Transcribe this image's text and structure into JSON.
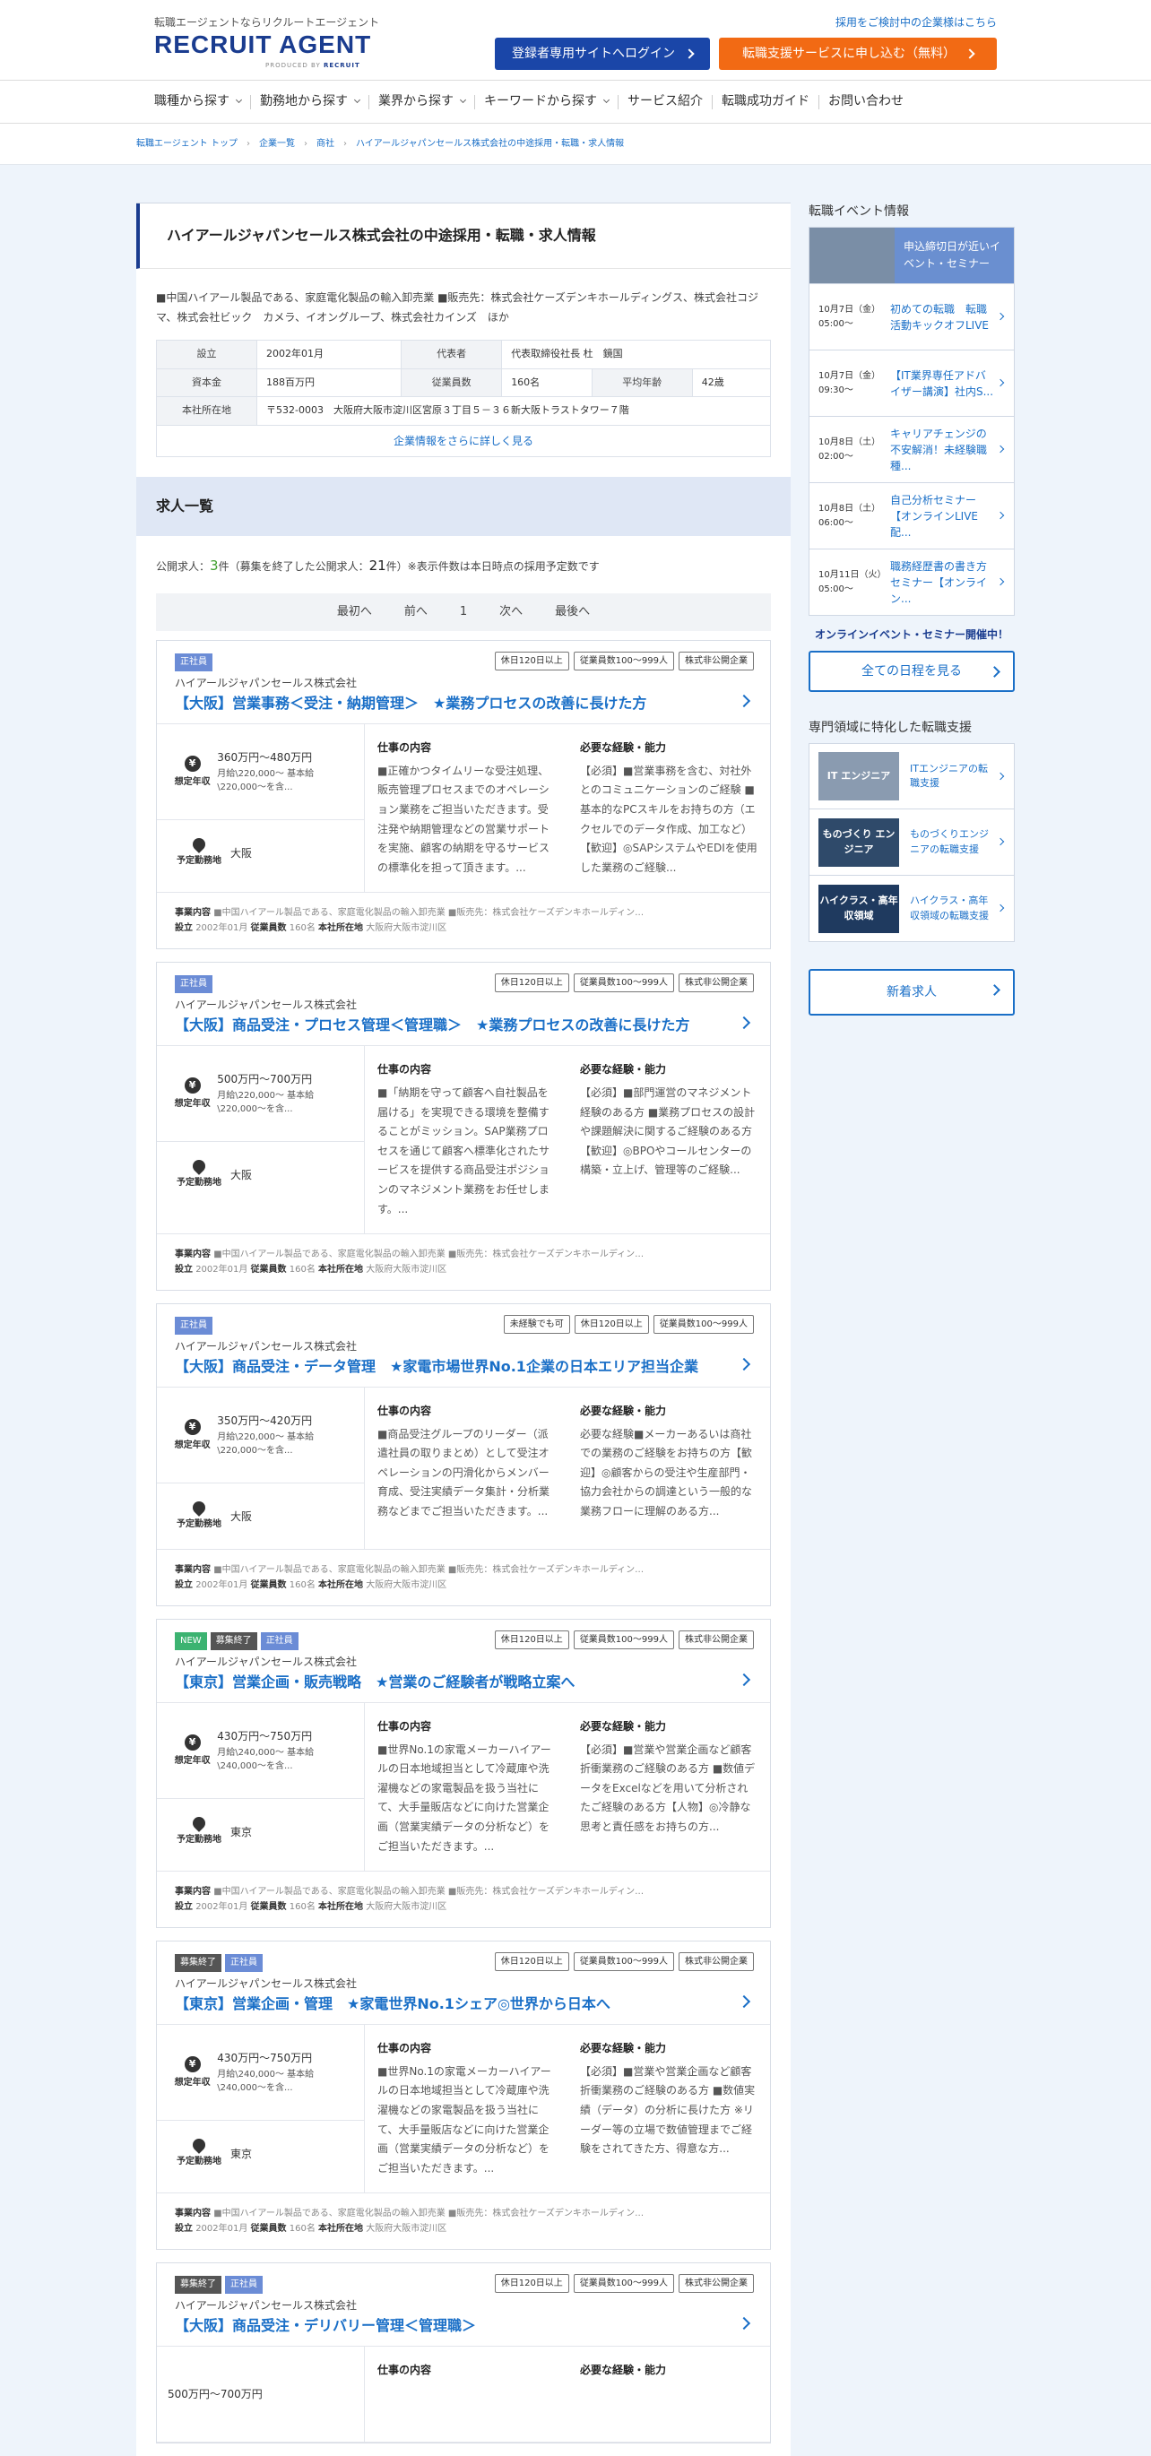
{
  "header": {
    "tagline": "転職エージェントならリクルートエージェント",
    "logo": "RECRUIT AGENT",
    "logo_sub": "PRODUCED BY",
    "logo_brand": "RECRUIT",
    "corp_link": "採用をご検討中の企業様はこちら",
    "login_btn": "登録者専用サイトへログイン",
    "apply_btn": "転職支援サービスに申し込む（無料）"
  },
  "nav": [
    "職種から探す",
    "勤務地から探す",
    "業界から探す",
    "キーワードから探す",
    "サービス紹介",
    "転職成功ガイド",
    "お問い合わせ"
  ],
  "breadcrumb": [
    "転職エージェント トップ",
    "企業一覧",
    "商社",
    "ハイアールジャパンセールス株式会社の中途採用・転職・求人情報"
  ],
  "company": {
    "title": "ハイアールジャパンセールス株式会社の中途採用・転職・求人情報",
    "summary": "■中国ハイアール製品である、家庭電化製品の輸入卸売業 ■販売先：株式会社ケーズデンキホールディングス、株式会社コジマ、株式会社ビック　カメラ、イオングループ、株式会社カインズ　ほか",
    "info": {
      "founded_label": "設立",
      "founded": "2002年01月",
      "rep_label": "代表者",
      "rep": "代表取締役社長 杜　鏡国",
      "capital_label": "資本金",
      "capital": "188百万円",
      "employees_label": "従業員数",
      "employees": "160名",
      "age_label": "平均年齢",
      "age": "42歳",
      "hq_label": "本社所在地",
      "hq": "〒532-0003　大阪府大阪市淀川区宮原３丁目５－３６新大阪トラストタワー７階"
    },
    "more": "企業情報をさらに詳しく見る"
  },
  "jobs_header": "求人一覧",
  "counts": {
    "pre": "公開求人：",
    "open": "3",
    "mid": "件（募集を終了した公開求人：",
    "closed": "21",
    "post": "件）※表示件数は本日時点の採用予定数です"
  },
  "pager": {
    "first": "最初へ",
    "prev": "前へ",
    "page": "1",
    "next": "次へ",
    "last": "最後へ"
  },
  "labels": {
    "salary": "想定年収",
    "location": "予定勤務地",
    "work": "仕事の内容",
    "req": "必要な経験・能力",
    "biz": "事業内容",
    "biz_text": "■中国ハイアール製品である、家庭電化製品の輸入卸売業 ■販売先：株式会社ケーズデンキホールディン…",
    "f_label": "設立",
    "f_val": "2002年01月",
    "e_label": "従業員数",
    "e_val": "160名",
    "h_label": "本社所在地",
    "h_val": "大阪府大阪市淀川区"
  },
  "jobs": [
    {
      "tags": [
        "正社員"
      ],
      "features": [
        "休日120日以上",
        "従業員数100～999人",
        "株式非公開企業"
      ],
      "company": "ハイアールジャパンセールス株式会社",
      "title": "【大阪】営業事務＜受注・納期管理＞　★業務プロセスの改善に長けた方",
      "salary": "360万円～480万円",
      "salary_sub": "月給\\220,000～ 基本給\\220,000～を含...",
      "location": "大阪",
      "work": "■正確かつタイムリーな受注処理、販売管理プロセスまでのオペレーション業務をご担当いただきます。受注発や納期管理などの営業サポートを実施、顧客の納期を守るサービスの標準化を担って頂きます。...",
      "req": "【必須】■営業事務を含む、対社外とのコミュニケーションのご経験 ■基本的なPCスキルをお持ちの方（エクセルでのデータ作成、加工など）【歓迎】◎SAPシステムやEDIを使用した業務のご経験..."
    },
    {
      "tags": [
        "正社員"
      ],
      "features": [
        "休日120日以上",
        "従業員数100～999人",
        "株式非公開企業"
      ],
      "company": "ハイアールジャパンセールス株式会社",
      "title": "【大阪】商品受注・プロセス管理＜管理職＞　★業務プロセスの改善に長けた方",
      "salary": "500万円～700万円",
      "salary_sub": "月給\\220,000～ 基本給\\220,000～を含...",
      "location": "大阪",
      "work": "■「納期を守って顧客へ自社製品を届ける」を実現できる環境を整備することがミッション。SAP業務プロセスを通じて顧客へ標準化されたサービスを提供する商品受注ポジションのマネジメント業務をお任せします。...",
      "req": "【必須】■部門運営のマネジメント経験のある方 ■業務プロセスの設計や課題解決に関するご経験のある方【歓迎】◎BPOやコールセンターの構築・立上げ、管理等のご経験..."
    },
    {
      "tags": [
        "正社員"
      ],
      "features": [
        "未経験でも可",
        "休日120日以上",
        "従業員数100～999人"
      ],
      "company": "ハイアールジャパンセールス株式会社",
      "title": "【大阪】商品受注・データ管理　★家電市場世界No.1企業の日本エリア担当企業",
      "salary": "350万円～420万円",
      "salary_sub": "月給\\220,000～ 基本給\\220,000～を含...",
      "location": "大阪",
      "work": "■商品受注グループのリーダー（派遣社員の取りまとめ）として受注オペレーションの円滑化からメンバー育成、受注実績データ集計・分析業務などまでご担当いただきます。...",
      "req": "必要な経験■メーカーあるいは商社での業務のご経験をお持ちの方【歓迎】◎顧客からの受注や生産部門・協力会社からの調達という一般的な業務フローに理解のある方..."
    },
    {
      "tags": [
        "NEW",
        "募集終了",
        "正社員"
      ],
      "features": [
        "休日120日以上",
        "従業員数100～999人",
        "株式非公開企業"
      ],
      "company": "ハイアールジャパンセールス株式会社",
      "title": "【東京】営業企画・販売戦略　★営業のご経験者が戦略立案へ",
      "salary": "430万円～750万円",
      "salary_sub": "月給\\240,000～ 基本給\\240,000～を含...",
      "location": "東京",
      "work": "■世界No.1の家電メーカーハイアールの日本地域担当として冷蔵庫や洗濯機などの家電製品を扱う当社にて、大手量販店などに向けた営業企画（営業実績データの分析など）をご担当いただきます。...",
      "req": "【必須】■営業や営業企画など顧客折衝業務のご経験のある方 ■数値データをExcelなどを用いて分析されたご経験のある方【人物】◎冷静な思考と責任感をお持ちの方..."
    },
    {
      "tags": [
        "募集終了",
        "正社員"
      ],
      "features": [
        "休日120日以上",
        "従業員数100～999人",
        "株式非公開企業"
      ],
      "company": "ハイアールジャパンセールス株式会社",
      "title": "【東京】営業企画・管理　★家電世界No.1シェア◎世界から日本へ",
      "salary": "430万円～750万円",
      "salary_sub": "月給\\240,000～ 基本給\\240,000～を含...",
      "location": "東京",
      "work": "■世界No.1の家電メーカーハイアールの日本地域担当として冷蔵庫や洗濯機などの家電製品を扱う当社にて、大手量販店などに向けた営業企画（営業実績データの分析など）をご担当いただきます。...",
      "req": "【必須】■営業や営業企画など顧客折衝業務のご経験のある方 ■数値実績（データ）の分析に長けた方 ※リーダー等の立場で数値管理までご経験をされてきた方、得意な方..."
    },
    {
      "tags": [
        "募集終了",
        "正社員"
      ],
      "features": [
        "休日120日以上",
        "従業員数100～999人",
        "株式非公開企業"
      ],
      "company": "ハイアールジャパンセールス株式会社",
      "title": "【大阪】商品受注・デリバリー管理＜管理職＞",
      "salary": "500万円～700万円",
      "salary_sub": "",
      "location": "",
      "work": "",
      "req": ""
    }
  ],
  "sidebar": {
    "events_h": "転職イベント情報",
    "banner": "申込締切日が近いイベント・セミナー",
    "events": [
      {
        "date": "10月7日（金）05:00～",
        "title": "初めての転職　転職活動キックオフLIVE"
      },
      {
        "date": "10月7日（金）09:30～",
        "title": "【IT業界専任アドバイザー講演】社内S..."
      },
      {
        "date": "10月8日（土）02:00～",
        "title": "キャリアチェンジの不安解消！未経験職種..."
      },
      {
        "date": "10月8日（土）06:00～",
        "title": "自己分析セミナー【オンラインLIVE配..."
      },
      {
        "date": "10月11日（火）05:00～",
        "title": "職務経歴書の書き方セミナー【オンライン..."
      }
    ],
    "note": "オンラインイベント・セミナー開催中！",
    "all_btn": "全ての日程を見る",
    "special_h": "専門領域に特化した転職支援",
    "special": [
      {
        "img": "IT エンジニア",
        "text": "ITエンジニアの転職支援"
      },
      {
        "img": "ものづくり エンジニア",
        "text": "ものづくりエンジニアの転職支援"
      },
      {
        "img": "ハイクラス・高年収領域",
        "text": "ハイクラス・高年収領域の転職支援"
      }
    ],
    "new_btn": "新着求人"
  },
  "colors": {
    "brand": "#1a3c8f",
    "link": "#1a6fc7",
    "orange": "#f26a14",
    "tag": "#6b8cd6"
  }
}
